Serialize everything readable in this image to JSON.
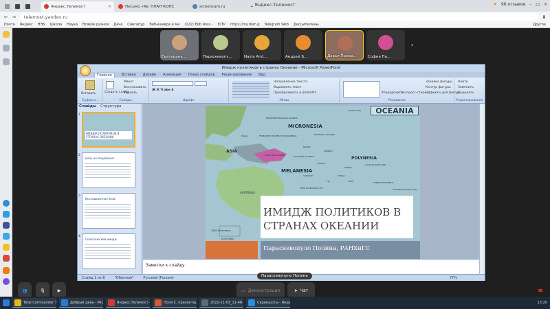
{
  "browser": {
    "tabs": [
      {
        "label": "Яндекс.Телемост",
        "color": "#d23b2f",
        "active": true
      },
      {
        "label": "Письмо «Re: ПЛАН КОНС",
        "color": "#e0372b",
        "active": false
      },
      {
        "label": "screencam.ru",
        "color": "#5a7bb5",
        "active": false
      }
    ],
    "window_title": "Яндекс.Телемост",
    "reviews": "96 отзывов",
    "url": "telemost.yandex.ru",
    "bookmarks": [
      "Почта",
      "Яндекс",
      "НЭБ",
      "Школа",
      "Наука",
      "Всякое разное",
      "Дача",
      "Сингапур",
      "Веб-камера и ми",
      "(122) Bob Ross -",
      "ЮТР",
      "https://my.dom.g",
      "Telegram Web",
      "Дисципилины"
    ],
    "bookmarks_other": "Другое"
  },
  "participants": [
    {
      "name": "Екатерина...",
      "bg": "#6d7075",
      "avatar": "#c9a27d"
    },
    {
      "name": "Параскевопу...",
      "bg": "#343434",
      "avatar": "#b7c98e"
    },
    {
      "name": "Nayla And...",
      "bg": "#343434",
      "avatar": "#e8a63a"
    },
    {
      "name": "Андрей Б...",
      "bg": "#343434",
      "avatar": "#e88d2f"
    },
    {
      "name": "Дарья Панар...",
      "bg": "#8d6d5e",
      "avatar": "#b06f59"
    },
    {
      "name": "София Па...",
      "bg": "#343434",
      "avatar": "#d24f92"
    }
  ],
  "ppt": {
    "title": "Имидж политиков в странах Океании - Microsoft PowerPoint",
    "menu": [
      "Главная",
      "Вставка",
      "Дизайн",
      "Анимация",
      "Показ слайдов",
      "Рецензирование",
      "Вид"
    ],
    "ribbon": {
      "paste": "Вставить",
      "new_slide": "Создать слайд",
      "layout": "Макет",
      "reset": "Восстановить",
      "delete": "Удалить",
      "text_direction": "Направление текста",
      "align_text": "Выровнять текст",
      "smartart": "Преобразовать в SmartArt",
      "arrange": "Упорядочить",
      "quick_styles": "Экспресс-стили",
      "fill": "Заливка фигуры",
      "outline": "Контур фигуры",
      "effects": "Эффекты для фигур",
      "find": "Найти",
      "replace": "Заменить",
      "select": "Выделить",
      "group_clipboard": "Буфер о...",
      "group_slides": "Слайды",
      "group_font": "Шрифт",
      "group_paragraph": "Абзац",
      "group_drawing": "Рисование",
      "group_editing": "Редактирование"
    },
    "pane_tabs": [
      "Слайды",
      "Структура"
    ],
    "thumbnails": [
      {
        "num": "1",
        "text": "ИМИДЖ ПОЛИТИКОВ В СТРАНАХ ОКЕАНИИ"
      },
      {
        "num": "2",
        "text": "Цель исследования:"
      },
      {
        "num": "3",
        "text": "Исследованная база:"
      },
      {
        "num": "4",
        "text": "Политический имидж"
      }
    ],
    "slide": {
      "map_title": "OCEANIA",
      "title": "ИМИДЖ ПОЛИТИКОВ В СТРАНАХ ОКЕАНИИ",
      "subtitle": "Параскевопуло Полина, РАНХиГС",
      "map_labels": [
        "MICRONESIA",
        "POLYNESIA",
        "MELANESIA",
        "ASIA",
        "AUSTRALIA",
        "NORTHERN MARIANA ISLANDS",
        "PALAU",
        "FEDERATED STATES OF MICRONESIA",
        "MARSHALL ISLANDS",
        "NAURU",
        "KIRIBATI",
        "SOLOMON ISLANDS",
        "TUVALU",
        "SAMOA",
        "COOK ISLANDS (NZ)",
        "FRENCH POLYNESIA",
        "PITCAIRN ISLANDS (UK)",
        "TONGA",
        "NIUE",
        "VANUATU",
        "FIJI",
        "NEW CALEDONIA (FR)",
        "NEW ZEALAND",
        "PAPUA NEW GUINEA",
        "HAWAII (US)"
      ],
      "scale": [
        "1000 Kilometers",
        "1000 Miles"
      ]
    },
    "notes": "Заметки к слайду",
    "status": {
      "slide": "Слайд 1 из 8",
      "theme": "\"Обычная\"",
      "lang": "Русский (Россия)",
      "zoom": "77%"
    }
  },
  "presenter_label": "Параскевопуло Полина",
  "controls": {
    "demo": "Демонстрация",
    "chat": "Чат"
  },
  "taskbar": {
    "items": [
      "Total Commander 7...",
      "Добрый день - Micr...",
      "Яндекс.Телемост -...",
      "Поля С. презентаци...",
      "2022-11-03_11-48-58...",
      "Скриншоты - Яндек..."
    ],
    "time": "13:20"
  }
}
